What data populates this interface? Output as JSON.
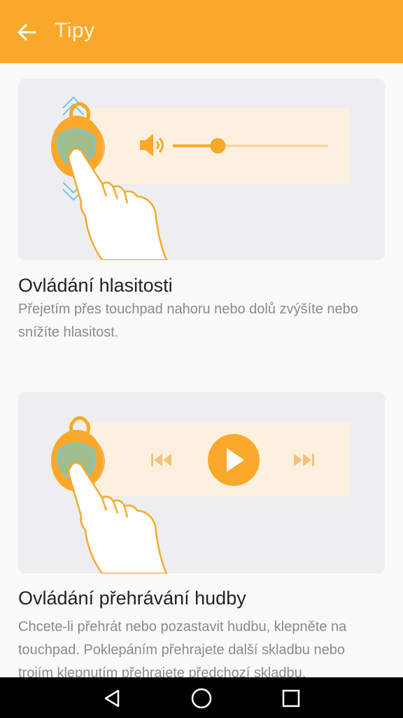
{
  "header": {
    "title": "Tipy",
    "back_icon": "arrow-left-icon",
    "bg_color": "#f9a82a"
  },
  "tips": [
    {
      "title": "Ovládání hlasitosti",
      "description": "Přejetím přes touchpad nahoru nebo dolů zvýšíte nebo snížíte hlasitost.",
      "illustration": "volume-swipe-illustration",
      "volume_level": 0.29
    },
    {
      "title": "Ovládání přehrávání hudby",
      "description": "Chcete-li přehrát nebo pozastavit hudbu, klepněte na touchpad. Poklepáním přehrajete další skladbu nebo trojím klepnutím přehrajete předchozí skladbu.",
      "illustration": "music-playback-illustration"
    }
  ],
  "navbar": {
    "back_icon": "nav-back-icon",
    "home_icon": "nav-home-icon",
    "recents_icon": "nav-recents-icon"
  }
}
